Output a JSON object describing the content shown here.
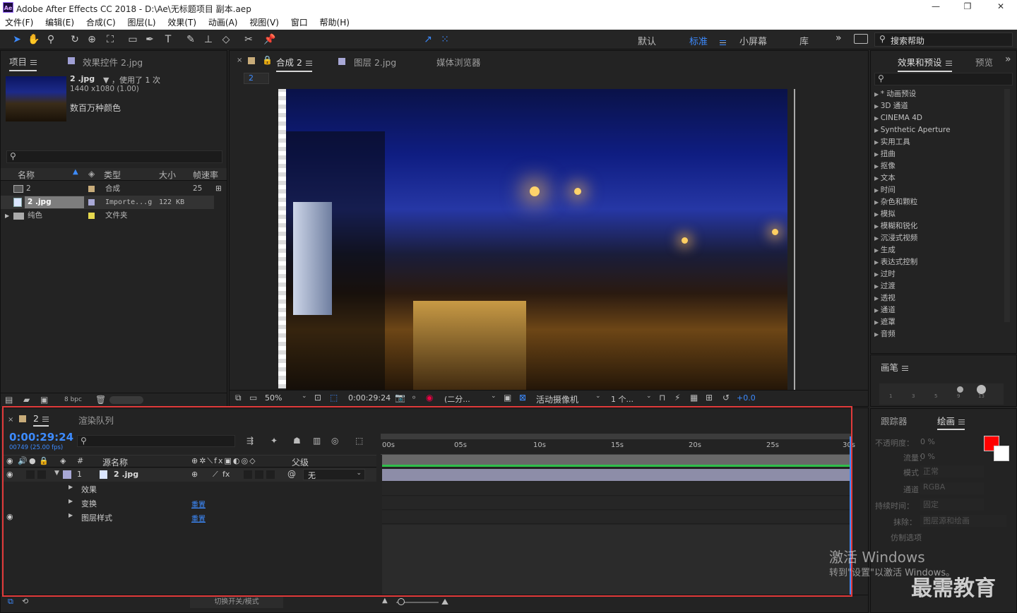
{
  "app": {
    "title": "Adobe After Effects CC 2018 - D:\\Ae\\无标题项目 副本.aep",
    "logo": "Ae"
  },
  "window_controls": {
    "minimize": "—",
    "maximize": "❐",
    "close": "✕"
  },
  "menu": [
    "文件(F)",
    "编辑(E)",
    "合成(C)",
    "图层(L)",
    "效果(T)",
    "动画(A)",
    "视图(V)",
    "窗口",
    "帮助(H)"
  ],
  "toolbar": {
    "snap_label": "对齐",
    "workspaces": [
      "默认",
      "标准",
      "小屏幕",
      "库"
    ],
    "active_workspace": "标准",
    "search_placeholder": "搜索帮助"
  },
  "project": {
    "tab": "项目",
    "effect_controls_tab": "效果控件 2.jpg",
    "selected_name": "2 .jpg",
    "used": "▼ ，使用了 1 次",
    "dims": "1440 x1080 (1.00)",
    "colors": "数百万种颜色",
    "search_placeholder": "",
    "columns": [
      "名称",
      "类型",
      "大小",
      "帧速率"
    ],
    "items": [
      {
        "name": "2",
        "type": "合成",
        "size": "",
        "fps": "25",
        "icon": "composition-icon"
      },
      {
        "name": "2 .jpg",
        "type": "Importe...g",
        "size": "122 KB",
        "fps": "",
        "icon": "image-file-icon"
      },
      {
        "name": "纯色",
        "type": "文件夹",
        "size": "",
        "fps": "",
        "icon": "folder-icon"
      }
    ],
    "bpc": "8 bpc"
  },
  "comp": {
    "tab": "合成 2",
    "layer_tab": "图层 2.jpg",
    "browser_tab": "媒体浏览器",
    "breadcrumb": "2",
    "zoom": "50%",
    "timecode": "0:00:29:24",
    "resolution": "(二分...",
    "camera": "活动摄像机",
    "views": "1 个...",
    "exposure": "+0.0"
  },
  "effects": {
    "tab": "效果和预设",
    "preview_tab": "预览",
    "items": [
      "* 动画预设",
      "3D 通道",
      "CINEMA 4D",
      "Synthetic Aperture",
      "实用工具",
      "扭曲",
      "抠像",
      "文本",
      "时间",
      "杂色和颗粒",
      "模拟",
      "模糊和锐化",
      "沉浸式视频",
      "生成",
      "表达式控制",
      "过时",
      "过渡",
      "透视",
      "通道",
      "遮罩",
      "音频"
    ]
  },
  "brush": {
    "tab": "画笔",
    "sizes": [
      "1",
      "3",
      "5",
      "9",
      "13"
    ]
  },
  "paint": {
    "tracker_tab": "跟踪器",
    "paint_tab": "绘画",
    "opacity_label": "不透明度：",
    "opacity": "0 %",
    "flow_label": "流量：",
    "flow": "0 %",
    "mode_label": "模式：",
    "mode": "正常",
    "channel_label": "通道：",
    "channel": "RGBA",
    "duration_label": "持续时间：",
    "duration": "固定",
    "erase_label": "抹除：",
    "erase": "图层源和绘画",
    "clone_label": "仿制选项",
    "foreground_color": "#ff0000",
    "background_color": "#ffffff"
  },
  "timeline": {
    "tab": "2",
    "render_tab": "渲染队列",
    "timecode": "0:00:29:24",
    "frames": "00749 (25.00 fps)",
    "search_placeholder": "",
    "col_source": "源名称",
    "col_parent": "父级",
    "layer_index": "1",
    "layer_name": "2 .jpg",
    "parent_value": "无",
    "props": [
      {
        "name": "效果",
        "value": ""
      },
      {
        "name": "变换",
        "value": "重置"
      },
      {
        "name": "图层样式",
        "value": "重置"
      }
    ],
    "ruler": [
      "00s",
      "05s",
      "10s",
      "15s",
      "20s",
      "25s",
      "30s"
    ],
    "footer": "切换开关/模式"
  },
  "watermark": {
    "line1": "激活 Windows",
    "line2": "转到\"设置\"以激活 Windows。",
    "brand": "最需教育"
  },
  "colors": {
    "accent": "#3d8bff",
    "highlight": "#e23b3b"
  }
}
